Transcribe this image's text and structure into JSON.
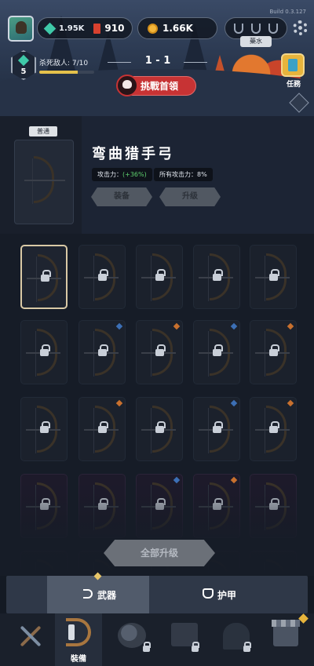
{
  "header": {
    "version": "Build 0.3.127",
    "gems": "1.95K",
    "crystals": "910",
    "gold": "1.66K",
    "potion_label": "藥水",
    "player_level": "5",
    "kill_text": "杀死敌人: 7/10",
    "kill_progress": 0.7,
    "stage": "1 - 1",
    "boss_button": "挑戰首領",
    "task_label": "任務"
  },
  "detail": {
    "rarity": "普通",
    "name": "弯曲猎手弓",
    "attack_label": "攻击力：",
    "attack_value": "(+36%)",
    "all_attack": "所有攻击力：8%",
    "equip_button": "装备",
    "upgrade_button": "升级"
  },
  "grid": {
    "upgrade_all": "全部升级"
  },
  "tabs": {
    "weapons": "武器",
    "armor": "护甲"
  },
  "nav": {
    "equipment": "裝備"
  },
  "colors": {
    "boss_red": "#c73334",
    "gem_teal": "#3fc9a8",
    "gold": "#f4b63a",
    "selected_border": "#d9c9a6"
  }
}
